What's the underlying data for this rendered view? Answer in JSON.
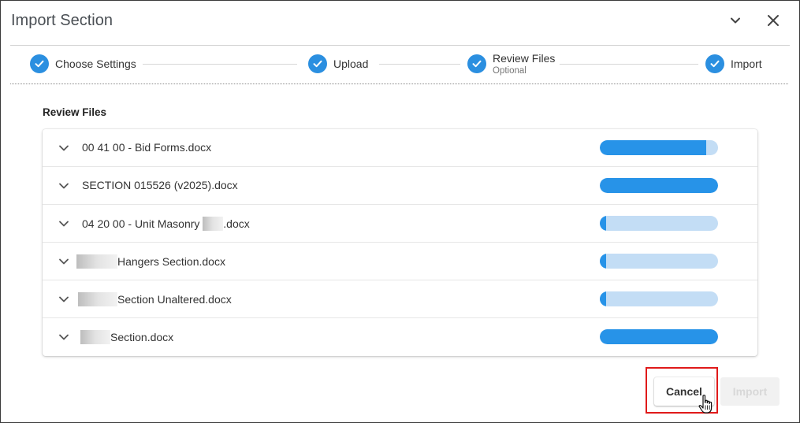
{
  "dialog": {
    "title": "Import Section",
    "collapse_icon": "chevron-down-icon",
    "close_icon": "close-icon"
  },
  "stepper": {
    "steps": [
      {
        "label": "Choose Settings",
        "sub": "",
        "state": "complete"
      },
      {
        "label": "Upload",
        "sub": "",
        "state": "complete"
      },
      {
        "label": "Review Files",
        "sub": "Optional",
        "state": "complete"
      },
      {
        "label": "Import",
        "sub": "",
        "state": "complete"
      }
    ]
  },
  "review": {
    "title": "Review Files",
    "files": [
      {
        "name_before": "00 41 00 - Bid Forms.docx",
        "name_after": "",
        "progress": 0.9
      },
      {
        "name_before": "SECTION 015526 (v2025).docx",
        "name_after": "",
        "progress": 1.0
      },
      {
        "name_before": "04 20 00 - Unit Masonry ",
        "name_after": ".docx",
        "progress": 0.05
      },
      {
        "name_before": "",
        "name_after": "Hangers Section.docx",
        "progress": 0.05
      },
      {
        "name_before": "",
        "name_after": "Section Unaltered.docx",
        "progress": 0.05
      },
      {
        "name_before": "",
        "name_after": "Section.docx",
        "progress": 1.0
      }
    ]
  },
  "footer": {
    "cancel_label": "Cancel",
    "import_label": "Import"
  },
  "colors": {
    "accent": "#2b8fe0",
    "progress_fill": "#2793e8",
    "progress_track": "#c3ddf5",
    "highlight": "#e01a1a"
  }
}
